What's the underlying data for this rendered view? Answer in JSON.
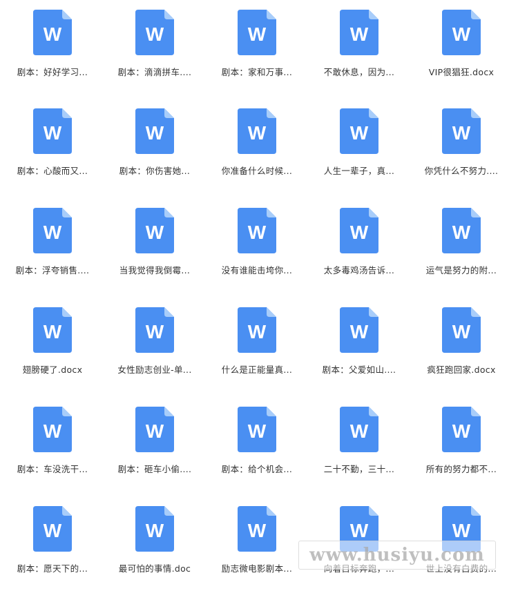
{
  "colors": {
    "icon_blue": "#4a8ff2",
    "icon_fold": "#a8cdfa",
    "icon_letter": "#ffffff",
    "label_text": "#333333"
  },
  "icon": {
    "name": "word-document-icon",
    "letter": "W"
  },
  "files": [
    {
      "name": "剧本：好好学习..."
    },
    {
      "name": "剧本：滴滴拼车...."
    },
    {
      "name": "剧本：家和万事..."
    },
    {
      "name": "不敢休息，因为..."
    },
    {
      "name": "VIP很猖狂.docx"
    },
    {
      "name": "剧本：心酸而又..."
    },
    {
      "name": "剧本：你伤害她..."
    },
    {
      "name": "你准备什么时候..."
    },
    {
      "name": "人生一辈子，真..."
    },
    {
      "name": "你凭什么不努力...."
    },
    {
      "name": "剧本：浮夸销售...."
    },
    {
      "name": "当我觉得我倒霉..."
    },
    {
      "name": "没有谁能击垮你..."
    },
    {
      "name": "太多毒鸡汤告诉..."
    },
    {
      "name": "运气是努力的附..."
    },
    {
      "name": "翅膀硬了.docx"
    },
    {
      "name": "女性励志创业-单..."
    },
    {
      "name": "什么是正能量真..."
    },
    {
      "name": "剧本：父爱如山...."
    },
    {
      "name": "疯狂跑回家.docx"
    },
    {
      "name": "剧本：车没洗干..."
    },
    {
      "name": "剧本：砸车小偷...."
    },
    {
      "name": "剧本：给个机会..."
    },
    {
      "name": "二十不勤，三十..."
    },
    {
      "name": "所有的努力都不..."
    },
    {
      "name": "剧本：愿天下的..."
    },
    {
      "name": "最可怕的事情.doc"
    },
    {
      "name": "励志微电影剧本..."
    },
    {
      "name": "向着目标奔跑，..."
    },
    {
      "name": "世上没有白费的..."
    }
  ],
  "watermark": {
    "text": "www.husiyu.com"
  }
}
